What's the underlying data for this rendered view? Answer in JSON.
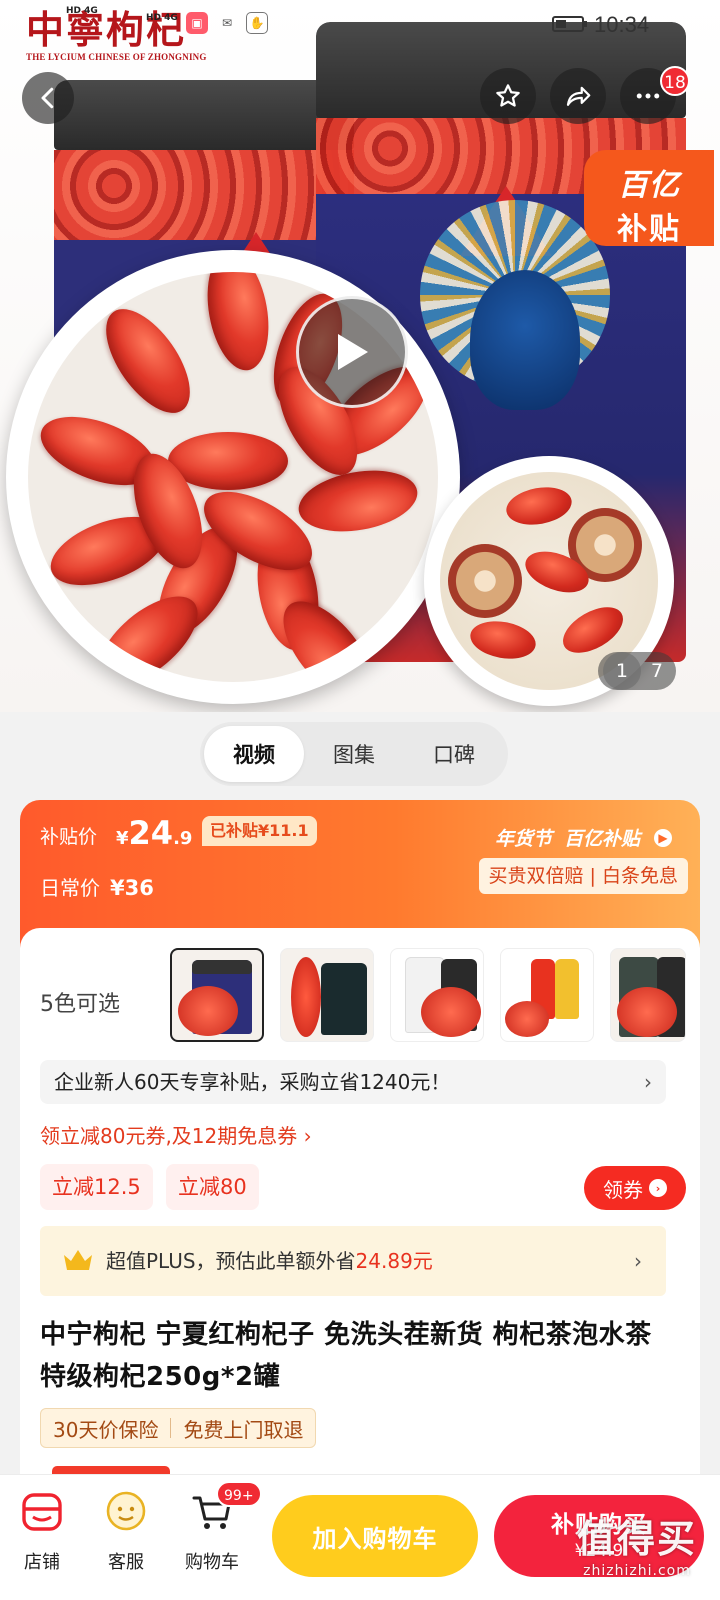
{
  "status_bar": {
    "net_top": "HD 4G",
    "net_bottom": "HD 4G",
    "time": "10:34"
  },
  "brand": {
    "logo_cn": "中寧枸杞",
    "logo_en": "THE LYCIUM CHINESE OF ZHONGNING"
  },
  "header": {
    "back_icon": "chevron-left-icon",
    "favorite_icon": "star-icon",
    "share_icon": "share-icon",
    "more_icon": "more-icon",
    "message_count": "18"
  },
  "gallery": {
    "subsidy_tag_line1": "百亿",
    "subsidy_tag_line2": "补贴",
    "current_page": "1",
    "total_pages": "7"
  },
  "media_tabs": [
    {
      "label": "视频",
      "active": true
    },
    {
      "label": "图集",
      "active": false
    },
    {
      "label": "口碑",
      "active": false
    }
  ],
  "price": {
    "subsidy_label": "补贴价",
    "currency": "¥",
    "price_int": "24",
    "price_dec": ".9",
    "subsidized_badge": "已补贴¥11.1",
    "daily_label": "日常价",
    "daily_price": "¥36",
    "festival_tag": "年货节",
    "program_tag": "百亿补贴",
    "guarantee": "买贵双倍赔 | 白条免息"
  },
  "variants": {
    "label": "5色可选",
    "count": 5
  },
  "newcomer": {
    "text": "企业新人60天专享补贴，采购立省1240元！",
    "chevron": "›"
  },
  "coupon": {
    "link": "领立减80元券,及12期免息券 ›",
    "chip1": "立减12.5",
    "chip2": "立减80",
    "get_label": "领券"
  },
  "plus": {
    "label": "超值PLUS，预估此单额外省",
    "amount": "24.89元",
    "chevron": "›"
  },
  "product": {
    "title": "中宁枸杞 宁夏红枸杞子 免洗头茬新货 枸杞茶泡水茶 特级枸杞250g*2罐",
    "tag1": "30天价保险",
    "tag2": "免费上门取退"
  },
  "bottom_bar": {
    "store_label": "店铺",
    "service_label": "客服",
    "cart_label": "购物车",
    "cart_badge": "99+",
    "add_to_cart": "加入购物车",
    "buy_label": "补贴购买",
    "buy_price": "¥24.9"
  },
  "watermark": {
    "cn": "值得买",
    "en": "zhizhizhi.com"
  },
  "colors": {
    "accent_orange": "#ff5a2c",
    "cart_yellow": "#ffcc1d",
    "buy_red": "#f3233d",
    "price_red": "#e8321f"
  }
}
